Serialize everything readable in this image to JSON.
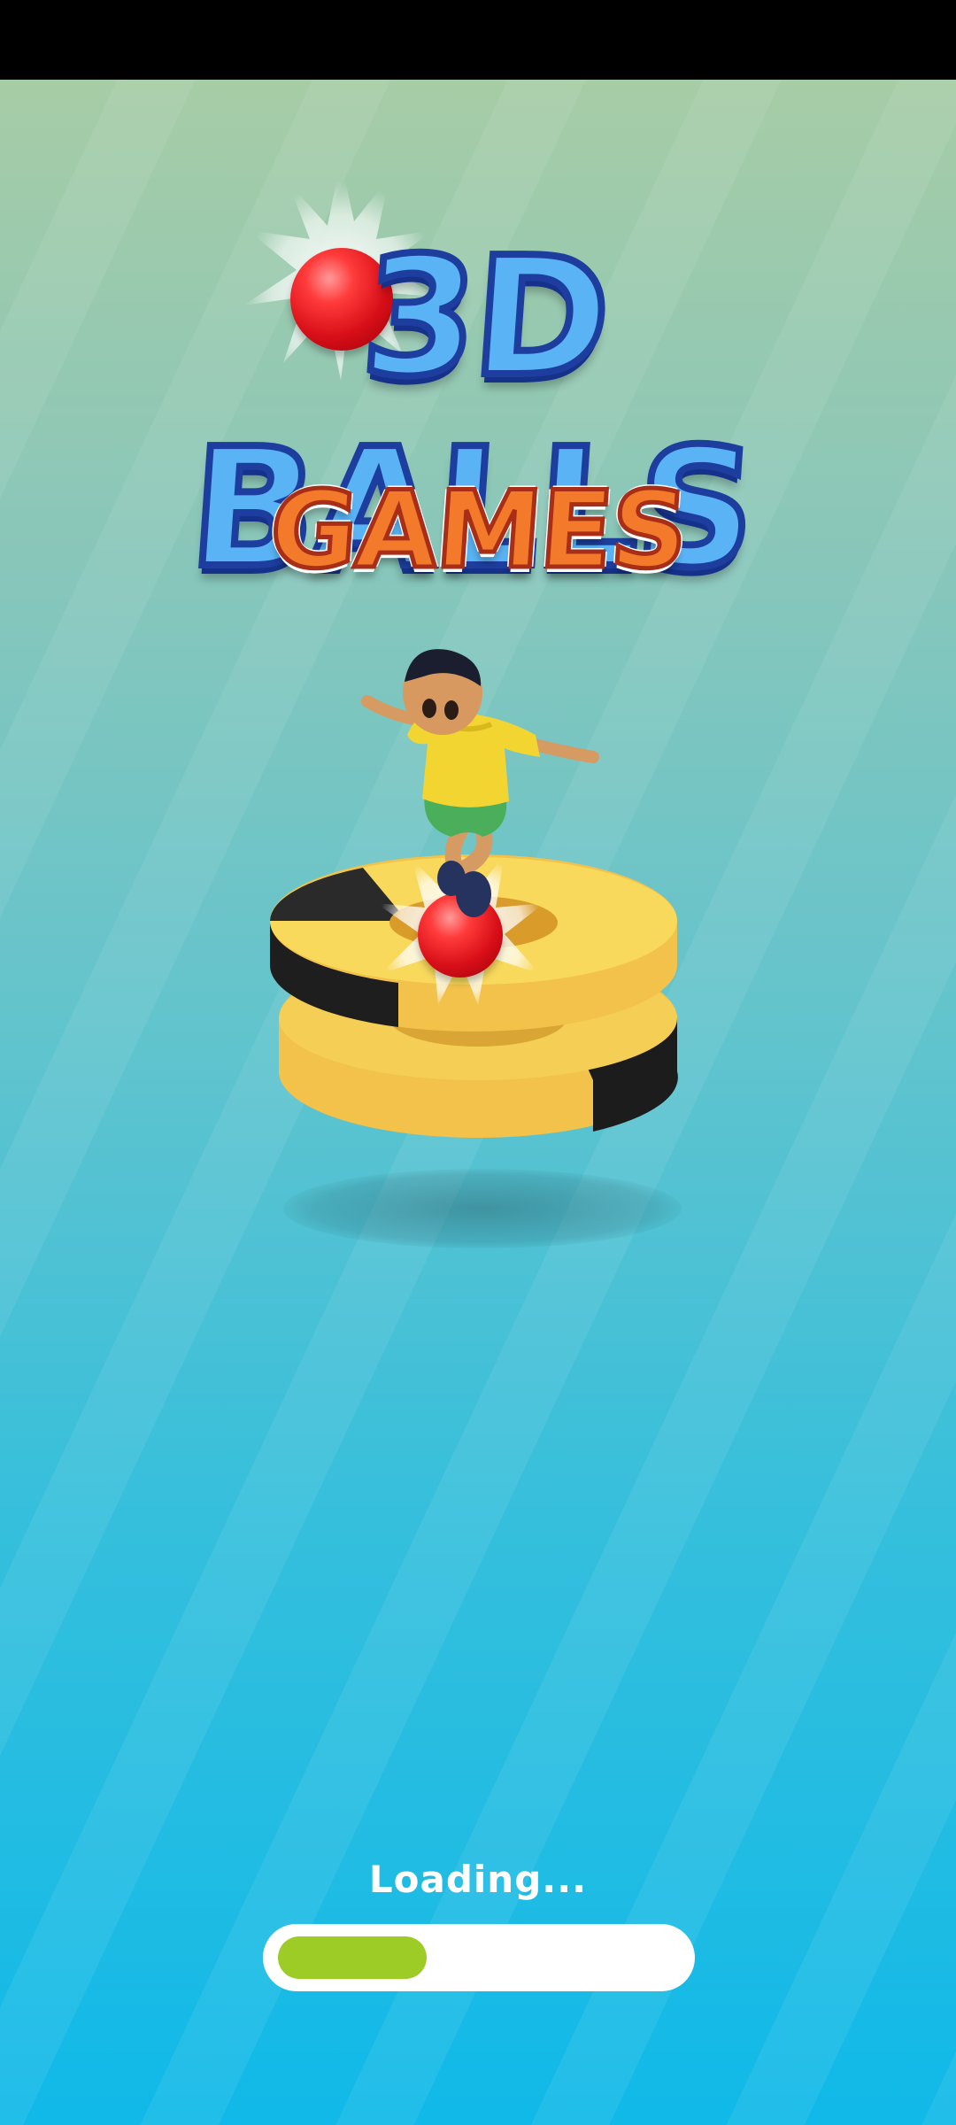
{
  "logo": {
    "line1": "3D BALLS",
    "line2": "GAMES"
  },
  "loading": {
    "label": "Loading...",
    "progress": 0.37
  },
  "colors": {
    "progress_fill": "#9ccc25",
    "progress_track": "#ffffff",
    "ball": "#e0141d",
    "platform_yellow": "#f5c944",
    "platform_black": "#1f1f1f"
  },
  "icons": {
    "ball": "red-ball-icon",
    "character": "jumping-boy-character"
  }
}
